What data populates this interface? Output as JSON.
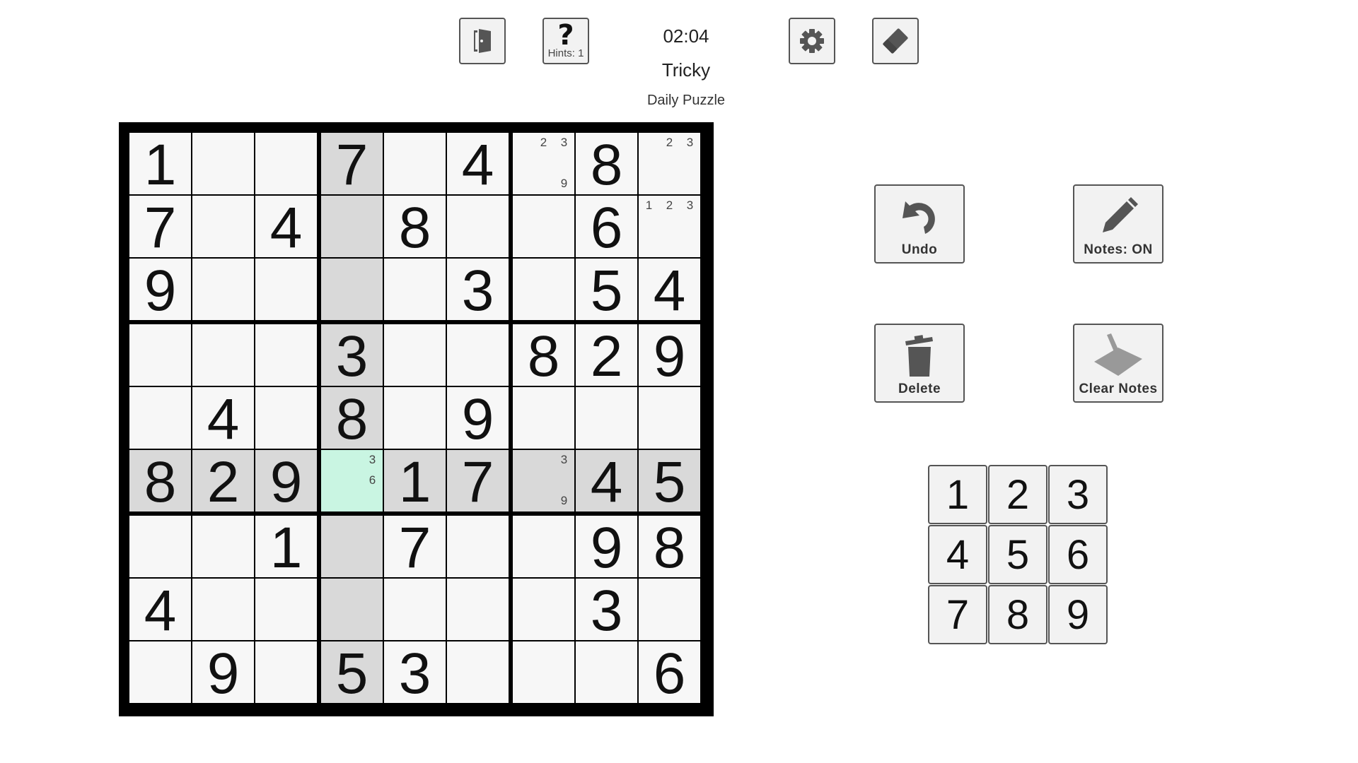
{
  "header": {
    "timer": "02:04",
    "difficulty": "Tricky",
    "subtitle": "Daily Puzzle",
    "hint_icon": "?",
    "hint_label": "Hints: 1",
    "icons": [
      "exit-door-icon",
      "hint-icon",
      "gear-icon",
      "eraser-icon"
    ]
  },
  "actions": {
    "undo": "Undo",
    "notes": "Notes: ON",
    "delete": "Delete",
    "clear_notes": "Clear Notes"
  },
  "numpad": [
    "1",
    "2",
    "3",
    "4",
    "5",
    "6",
    "7",
    "8",
    "9"
  ],
  "colors": {
    "cell": "#f7f7f7",
    "highlight": "#d9d9d9",
    "selected": "#c9f5e2",
    "border": "#000000"
  },
  "board": {
    "selected": [
      5,
      3
    ],
    "grid": [
      [
        "1",
        "",
        "",
        "7",
        "",
        "4",
        "",
        "8",
        ""
      ],
      [
        "7",
        "",
        "4",
        "",
        "8",
        "",
        "",
        "6",
        ""
      ],
      [
        "9",
        "",
        "",
        "",
        "",
        "3",
        "",
        "5",
        "4"
      ],
      [
        "",
        "",
        "",
        "3",
        "",
        "",
        "8",
        "2",
        "9"
      ],
      [
        "",
        "4",
        "",
        "8",
        "",
        "9",
        "",
        "",
        ""
      ],
      [
        "8",
        "2",
        "9",
        "",
        "1",
        "7",
        "",
        "4",
        "5"
      ],
      [
        "",
        "",
        "1",
        "",
        "7",
        "",
        "",
        "9",
        "8"
      ],
      [
        "4",
        "",
        "",
        "",
        "",
        "",
        "",
        "3",
        ""
      ],
      [
        "",
        "9",
        "",
        "5",
        "3",
        "",
        "",
        "",
        "6"
      ]
    ],
    "notes": {
      "0-6": [
        "2",
        "3",
        "9"
      ],
      "0-8": [
        "2",
        "3"
      ],
      "1-8": [
        "1",
        "2",
        "3"
      ],
      "5-3": [
        "3",
        "6"
      ],
      "5-6": [
        "3",
        "9"
      ]
    }
  }
}
